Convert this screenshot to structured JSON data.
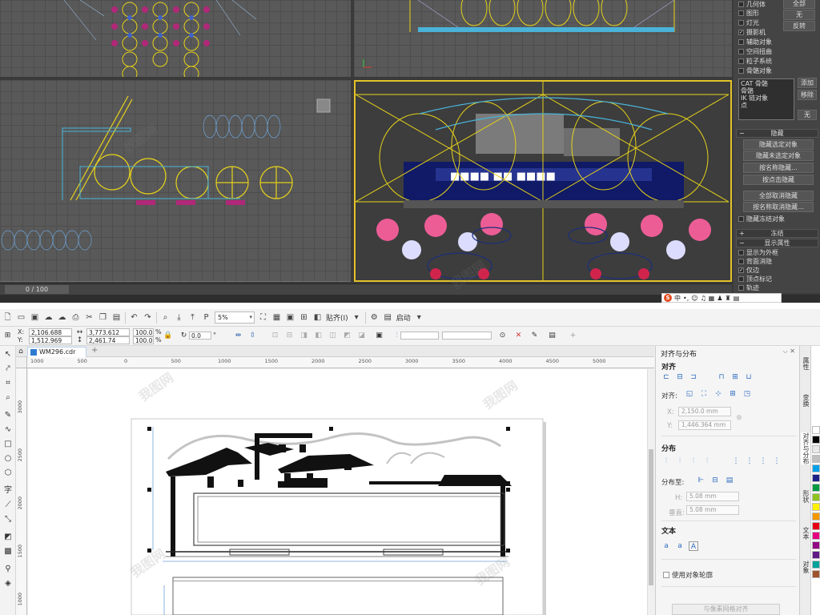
{
  "max": {
    "timeline": {
      "frame_counter": "0 / 100"
    },
    "filters": [
      {
        "label": "几何体",
        "checked": false
      },
      {
        "label": "图形",
        "checked": false
      },
      {
        "label": "灯光",
        "checked": false
      },
      {
        "label": "摄影机",
        "checked": true
      },
      {
        "label": "辅助对象",
        "checked": false
      },
      {
        "label": "空间扭曲",
        "checked": false
      },
      {
        "label": "粒子系统",
        "checked": false
      },
      {
        "label": "骨骼对象",
        "checked": false
      }
    ],
    "filter_buttons": {
      "all": "全部",
      "none": "无",
      "invert": "反转"
    },
    "selection_list": [
      "CAT 骨骼",
      "骨骼",
      "IK 链对象",
      "点"
    ],
    "selection_buttons": {
      "add": "添加",
      "remove": "移除",
      "none": "无"
    },
    "hide_rollout": {
      "title": "隐藏",
      "hide_selected": "隐藏选定对象",
      "hide_unselected": "隐藏未选定对象",
      "hide_by_name": "按名称隐藏...",
      "hide_by_hit": "按点击隐藏",
      "unhide_all": "全部取消隐藏",
      "unhide_by_name": "按名称取消隐藏...",
      "hide_frozen": "隐藏冻结对象"
    },
    "freeze_rollout": {
      "title": "冻结"
    },
    "display_props": {
      "title": "显示属性",
      "items": [
        {
          "label": "显示为外框",
          "checked": false
        },
        {
          "label": "背面消隐",
          "checked": false
        },
        {
          "label": "仅边",
          "checked": true
        },
        {
          "label": "顶点标记",
          "checked": false
        },
        {
          "label": "轨迹",
          "checked": false
        }
      ]
    },
    "ime": {
      "logo": "S",
      "lang": "中"
    }
  },
  "corel": {
    "toolbar": {
      "zoom": "5%",
      "snap_label": "贴齐(I)",
      "launch_label": "启动"
    },
    "props": {
      "x_label": "X:",
      "y_label": "Y:",
      "x": "2,106.688 mm",
      "y": "1,512.969 mm",
      "w": "3,773.612 mm",
      "h": "2,461.74 mm",
      "sx": "100.0",
      "sy": "100.0",
      "pct": "%",
      "angle": "0.0",
      "rot_unit": "°"
    },
    "doc_tab": "WM296.cdr",
    "ruler_h": [
      "1000",
      "500",
      "0",
      "500",
      "1000",
      "1500",
      "2000",
      "2500",
      "3000",
      "3500",
      "4000",
      "4500",
      "5000"
    ],
    "ruler_v": [
      "3000",
      "2500",
      "2000",
      "1500",
      "1000"
    ],
    "docker": {
      "title": "对齐与分布",
      "align_section": "对齐",
      "align_to": "对齐:",
      "x_label": "X:",
      "y_label": "Y:",
      "x_value": "2,150.0 mm",
      "y_value": "1,446.364 mm",
      "distribute_section": "分布",
      "distribute_to": "分布至:",
      "h_label": "H:",
      "v_label": "垂直:",
      "h_value": "5.08 mm",
      "v_value": "5.08 mm",
      "text_section": "文本",
      "use_outline": "使用对象轮廓",
      "grid_align": "与像素网格对齐"
    },
    "docker_tabs": [
      "属性",
      "变换",
      "对齐与分布",
      "形状",
      "文本",
      "对象"
    ],
    "palette": [
      "#ffffff",
      "#000000",
      "#e8e8e8",
      "#c0c0c0",
      "#00a0e9",
      "#1d2088",
      "#009944",
      "#8fc31f",
      "#fff100",
      "#f39800",
      "#e60012",
      "#e4007f",
      "#920783",
      "#601986",
      "#00a29a",
      "#a0522d"
    ]
  }
}
